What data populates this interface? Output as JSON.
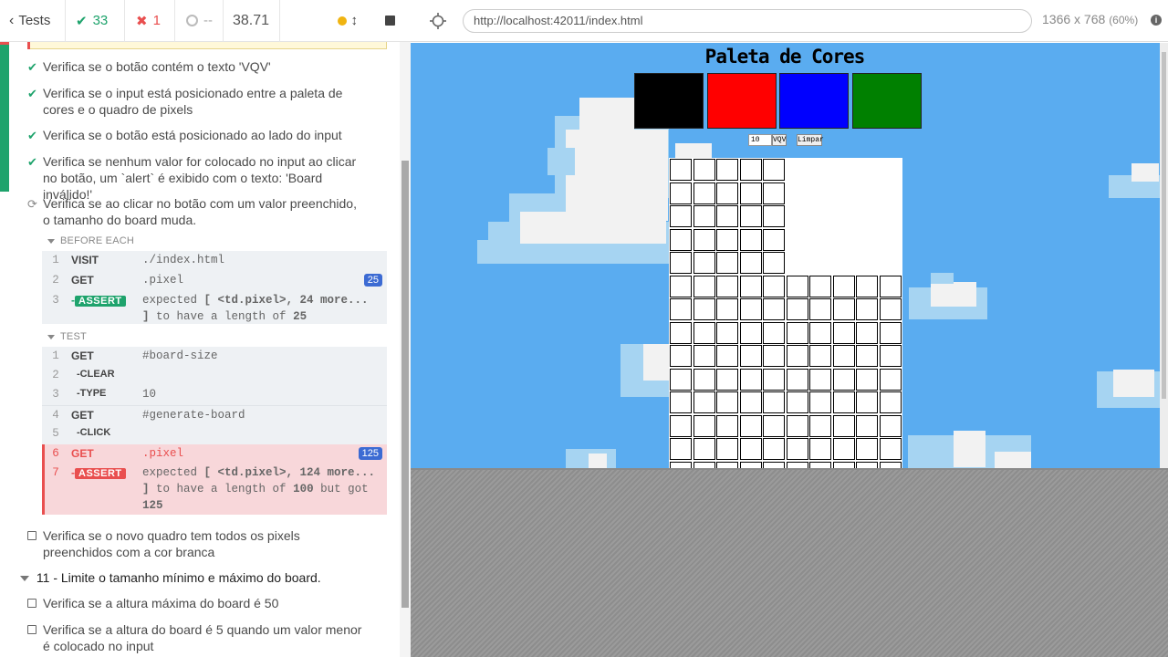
{
  "reporter": {
    "back_label": "Tests",
    "passed_count": "33",
    "failed_count": "1",
    "pending_count": "--",
    "duration": "38.71",
    "tests_top": [
      {
        "status": "passed",
        "text": "Verifica se o botão contém o texto 'VQV'"
      },
      {
        "status": "passed",
        "text": "Verifica se o input está posicionado entre a paleta de cores e o quadro de pixels"
      },
      {
        "status": "passed",
        "text": "Verifica se o botão está posicionado ao lado do input"
      },
      {
        "status": "passed",
        "text": "Verifica se nenhum valor for colocado no input ao clicar no botão, um `alert` é exibido com o texto: 'Board inválido!'"
      },
      {
        "status": "failed",
        "text": "Verifica se ao clicar no botão com um valor preenchido, o tamanho do board muda."
      }
    ],
    "before_each_label": "BEFORE EACH",
    "before_each": [
      {
        "num": "1",
        "name": "VISIT",
        "msg": "./index.html"
      },
      {
        "num": "2",
        "name": "GET",
        "msg": ".pixel",
        "badge": "25"
      },
      {
        "num": "3",
        "name": "ASSERT",
        "msg_pre": "expected",
        "msg_subject": "[ <td.pixel>, 24 more... ]",
        "msg_mid": "to have a length of",
        "msg_value": "25"
      }
    ],
    "test_label": "TEST",
    "test_cmds": [
      {
        "num": "1",
        "name": "GET",
        "msg": "#board-size"
      },
      {
        "num": "2",
        "name": "-CLEAR",
        "msg": ""
      },
      {
        "num": "3",
        "name": "-TYPE",
        "msg": "10"
      },
      {
        "num": "4",
        "name": "GET",
        "msg": "#generate-board"
      },
      {
        "num": "5",
        "name": "-CLICK",
        "msg": ""
      },
      {
        "num": "6",
        "name": "GET",
        "msg": ".pixel",
        "badge": "125"
      },
      {
        "num": "7",
        "name": "ASSERT",
        "msg_pre": "expected",
        "msg_subject": "[ <td.pixel>, 124 more... ]",
        "msg_mid": "to have a length of",
        "msg_value": "100",
        "msg_post": "but got",
        "msg_actual": "125"
      }
    ],
    "tests_bottom": [
      {
        "status": "pending",
        "text": "Verifica se o novo quadro tem todos os pixels preenchidos com a cor branca"
      }
    ],
    "suite_11_title": "11 - Limite o tamanho mínimo e máximo do board.",
    "suite_11_tests": [
      {
        "status": "pending",
        "text": "Verifica se a altura máxima do board é 50"
      },
      {
        "status": "pending",
        "text": "Verifica se a altura do board é 5 quando um valor menor é colocado no input"
      }
    ]
  },
  "aut": {
    "url": "http://localhost:42011/index.html",
    "viewport": "1366 x 768",
    "scale": "(60%)",
    "page": {
      "title": "Paleta de Cores",
      "palette": [
        "#000000",
        "#ff0000",
        "#0000ff",
        "#008000"
      ],
      "board_input_value": "10",
      "generate_button": "VQV",
      "clear_button": "Limpar",
      "board_shape": {
        "rows_top_small": 5,
        "cols_small": 5,
        "rows_full": 10,
        "cols_full": 10,
        "total_pixels": 125
      }
    }
  },
  "colors": {
    "pass": "#1ea36c",
    "fail": "#e94f4f",
    "sky": "#5aacf0"
  }
}
